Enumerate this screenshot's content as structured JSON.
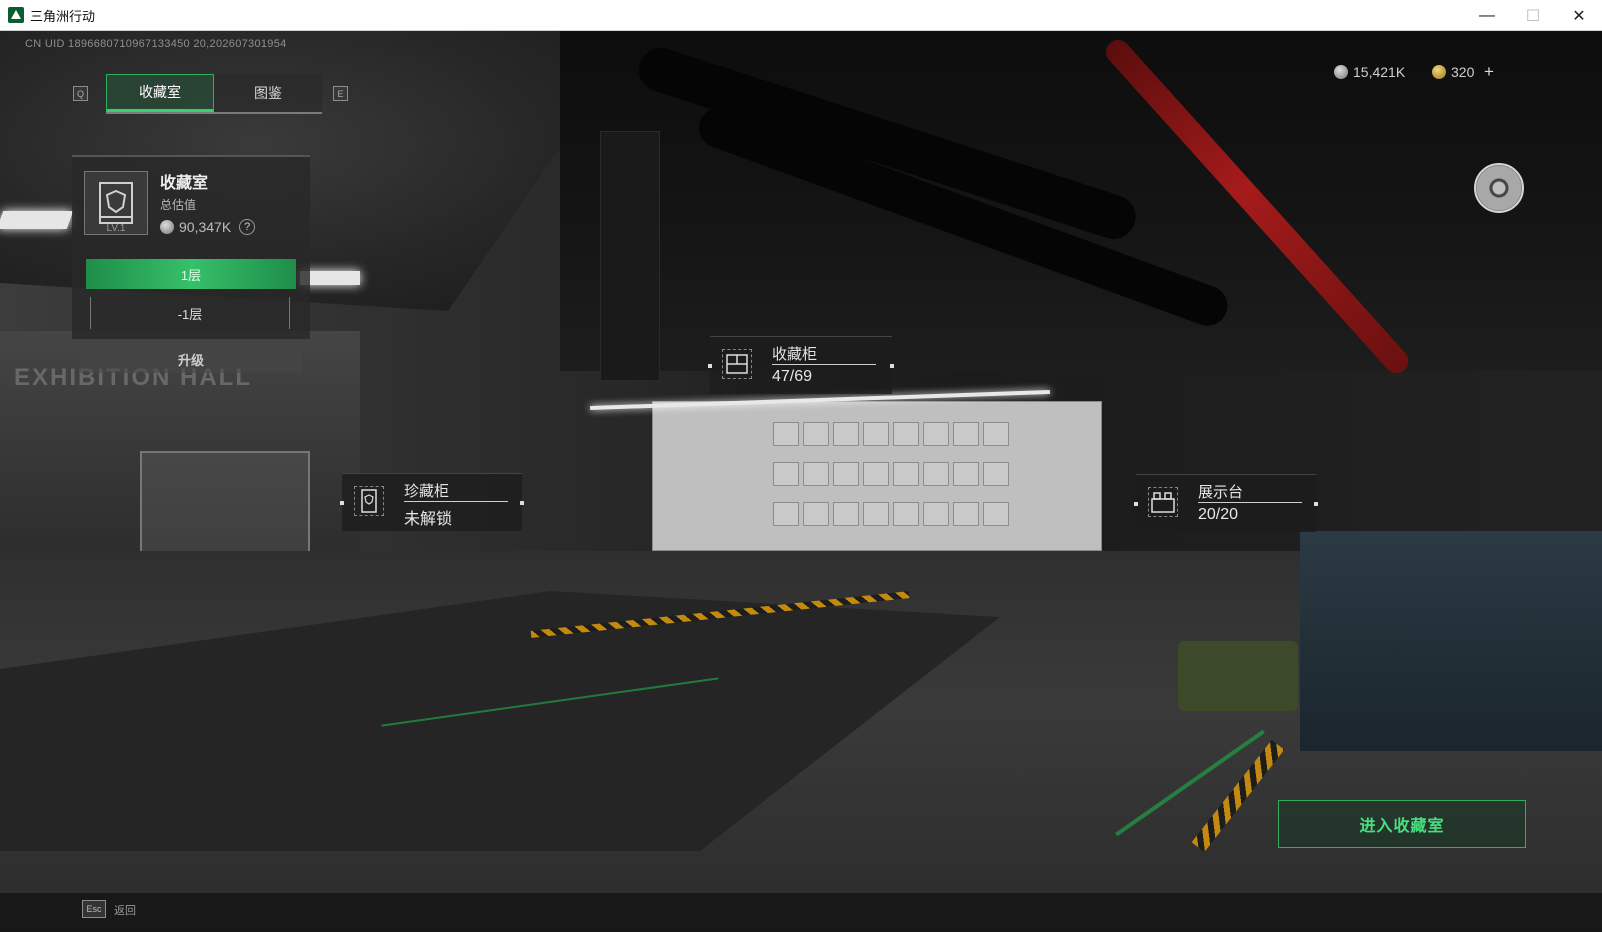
{
  "window": {
    "title": "三角洲行动",
    "minimize": "—",
    "maximize": "☐",
    "close": "✕"
  },
  "hud": {
    "uid": "CN UID 1896680710967133450 20,202607301954",
    "tab_key_left": "Q",
    "tab_key_right": "E",
    "tabs": [
      {
        "label": "收藏室",
        "active": true
      },
      {
        "label": "图鉴",
        "active": false
      }
    ],
    "currency": {
      "silver": "15,421K",
      "gold": "320",
      "plus": "+"
    }
  },
  "collection_panel": {
    "title": "收藏室",
    "level": "LV.1",
    "estimate_label": "总估值",
    "estimate_value": "90,347K",
    "help": "?",
    "floors": [
      {
        "label": "1层",
        "active": true
      },
      {
        "label": "-1层",
        "active": false
      }
    ],
    "upgrade_label": "升级"
  },
  "markers": {
    "cabinet": {
      "title": "收藏柜",
      "value": "47/69"
    },
    "rare_cabinet": {
      "title": "珍藏柜",
      "value": "未解锁"
    },
    "display_stand": {
      "title": "展示台",
      "value": "20/20"
    }
  },
  "actions": {
    "enter": "进入收藏室",
    "esc_key": "Esc",
    "back": "返回"
  },
  "scene_text": {
    "exhibition": "EXHIBITION HALL"
  },
  "colors": {
    "accent_green": "#36d06f",
    "pipe_red": "#a51b1b"
  }
}
